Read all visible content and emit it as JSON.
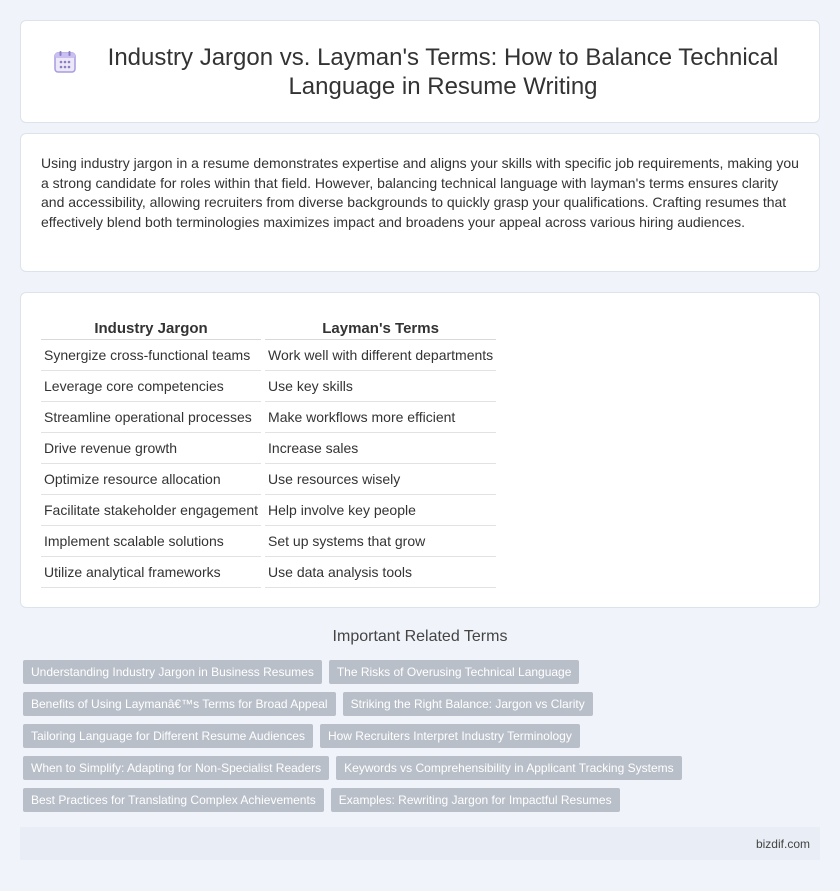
{
  "header": {
    "icon": "calendar-grid-icon",
    "title": "Industry Jargon vs. Layman's Terms: How to Balance Technical Language in Resume Writing"
  },
  "intro": {
    "text": "Using industry jargon in a resume demonstrates expertise and aligns your skills with specific job requirements, making you a strong candidate for roles within that field. However, balancing technical language with layman's terms ensures clarity and accessibility, allowing recruiters from diverse backgrounds to quickly grasp your qualifications. Crafting resumes that effectively blend both terminologies maximizes impact and broadens your appeal across various hiring audiences."
  },
  "table": {
    "headers": [
      "Industry Jargon",
      "Layman's Terms"
    ],
    "rows": [
      [
        "Synergize cross-functional teams",
        "Work well with different departments"
      ],
      [
        "Leverage core competencies",
        "Use key skills"
      ],
      [
        "Streamline operational processes",
        "Make workflows more efficient"
      ],
      [
        "Drive revenue growth",
        "Increase sales"
      ],
      [
        "Optimize resource allocation",
        "Use resources wisely"
      ],
      [
        "Facilitate stakeholder engagement",
        "Help involve key people"
      ],
      [
        "Implement scalable solutions",
        "Set up systems that grow"
      ],
      [
        "Utilize analytical frameworks",
        "Use data analysis tools"
      ]
    ]
  },
  "related": {
    "title": "Important Related Terms",
    "rows": [
      [
        "Understanding Industry Jargon in Business Resumes",
        "The Risks of Overusing Technical Language"
      ],
      [
        "Benefits of Using Laymanâ€™s Terms for Broad Appeal",
        "Striking the Right Balance: Jargon vs Clarity"
      ],
      [
        "Tailoring Language for Different Resume Audiences",
        "How Recruiters Interpret Industry Terminology"
      ],
      [
        "When to Simplify: Adapting for Non-Specialist Readers",
        "Keywords vs Comprehensibility in Applicant Tracking Systems"
      ],
      [
        "Best Practices for Translating Complex Achievements",
        "Examples: Rewriting Jargon for Impactful Resumes"
      ]
    ]
  },
  "footer": {
    "site": "bizdif.com"
  },
  "colors": {
    "background": "#f0f3f9",
    "tag": "#b9bfc9",
    "icon_accent": "#8e7cc3"
  }
}
